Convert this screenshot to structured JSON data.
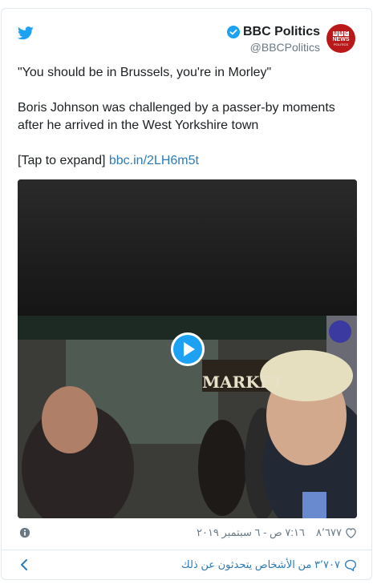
{
  "author": {
    "display_name": "BBC Politics",
    "handle": "@BBCPolitics",
    "avatar_lines": [
      "BBC",
      "NEWS",
      "POLITICS"
    ]
  },
  "tweet": {
    "line1": "\"You should be in Brussels, you're in Morley\"",
    "line2": "Boris Johnson was challenged by a passer-by moments after he arrived in the West Yorkshire town",
    "expand_label": "[Tap to expand]",
    "link_text": "bbc.in/2LH6m5t"
  },
  "media": {
    "type": "video",
    "shop_sign": "MARKET"
  },
  "meta": {
    "likes": "٨٬٦٧٧",
    "timestamp": "٧:١٦ ص - ٦ سبتمبر ٢٠١٩"
  },
  "footer": {
    "replies_text": "٣٬٧٠٧ من الأشخاص يتحدثون عن ذلك"
  },
  "colors": {
    "link": "#2b7bb9",
    "twitter_blue": "#1da1f2",
    "bbc_red": "#bb1919",
    "muted": "#697882"
  }
}
